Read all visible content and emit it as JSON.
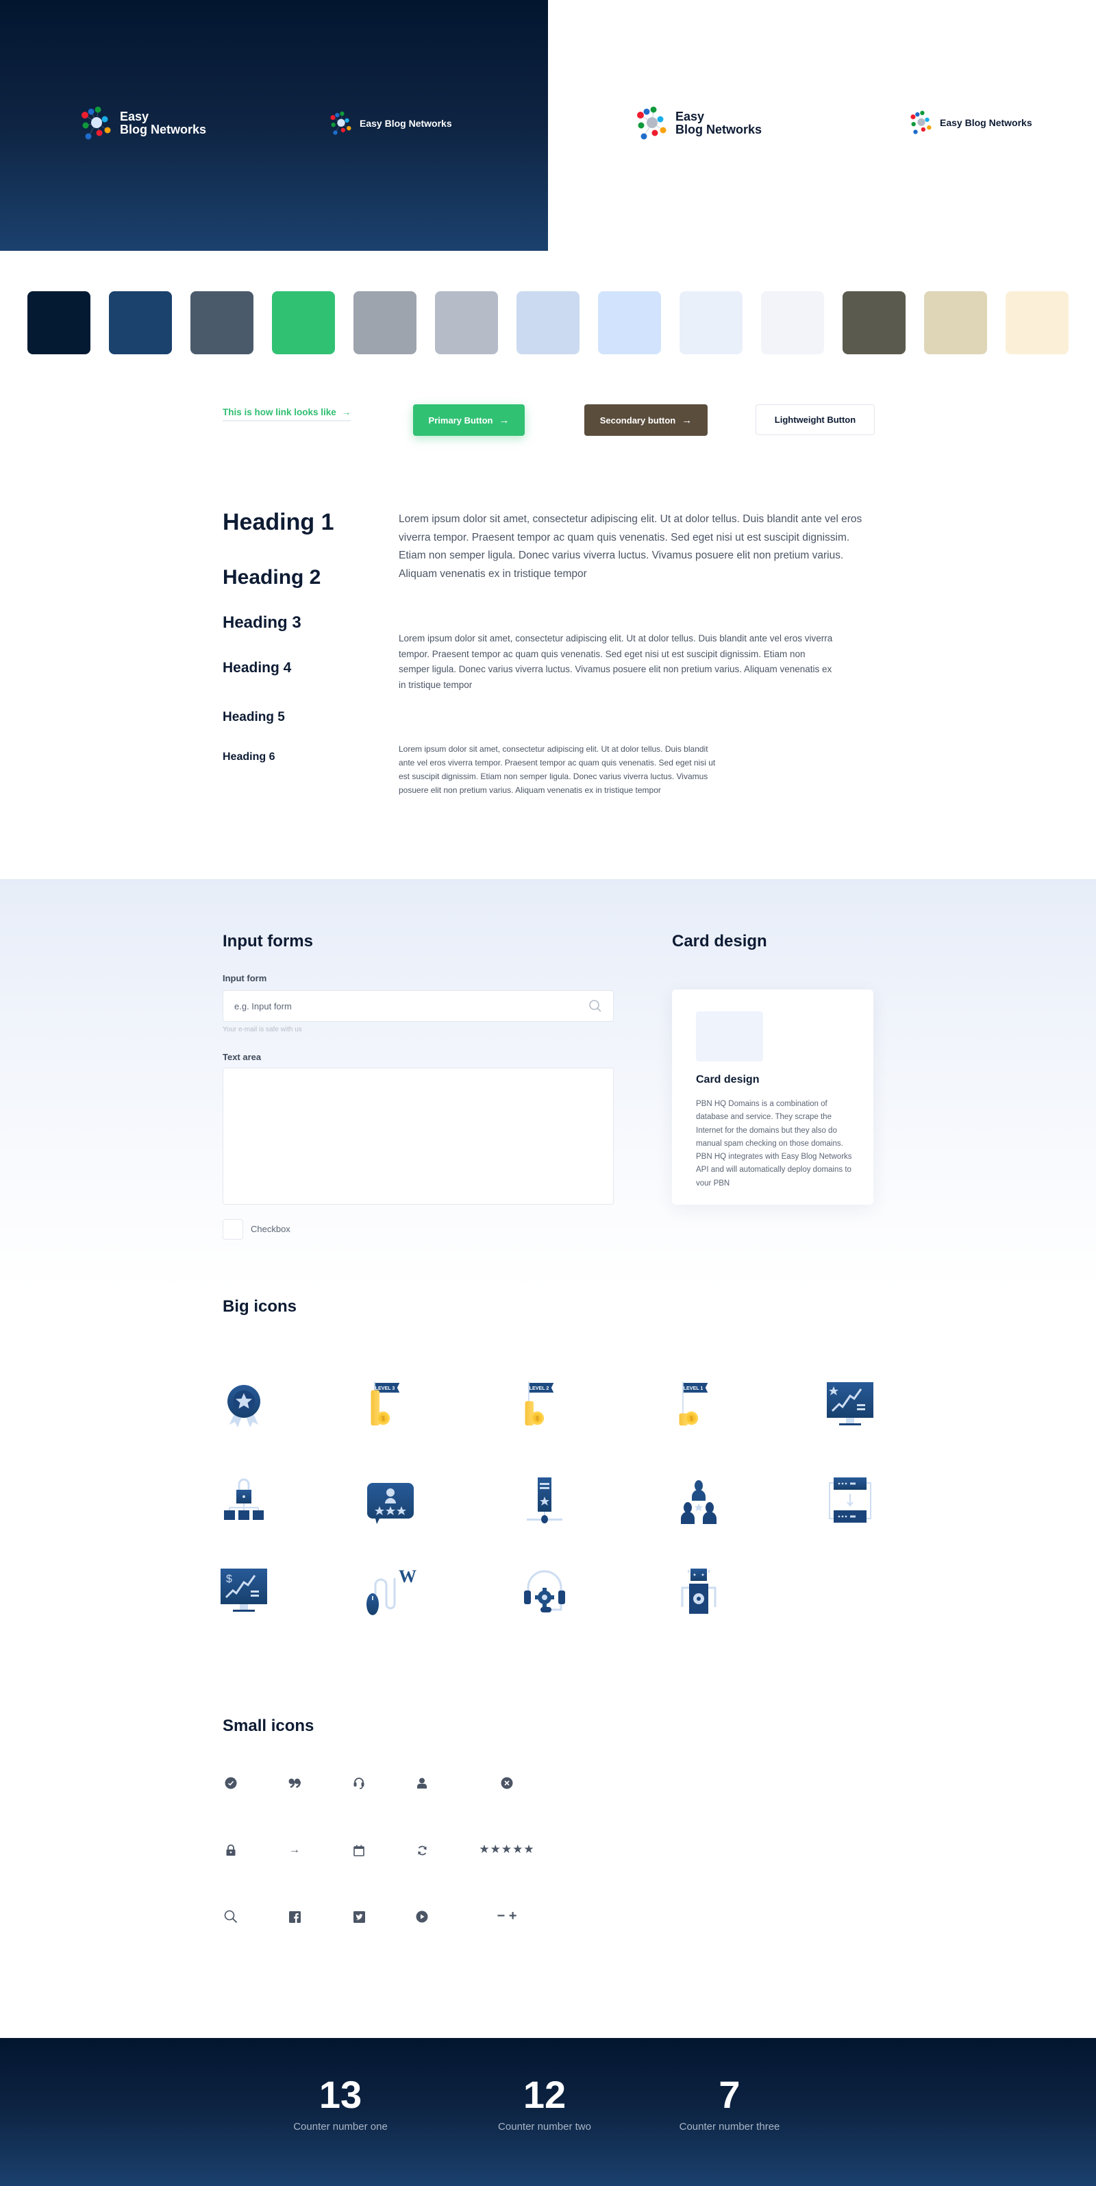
{
  "brand": {
    "name_line1": "Easy",
    "name_line2": "Blog Networks",
    "name_full": "Easy Blog Networks"
  },
  "palette": {
    "colors": [
      "#041a33",
      "#1b416d",
      "#4b5a6b",
      "#31c173",
      "#9da4ae",
      "#b5bcc8",
      "#cbdaf0",
      "#d2e4fd",
      "#eaf0fa",
      "#f2f4f9",
      "#5b5a4e",
      "#dfd6b8",
      "#fbf0d7"
    ]
  },
  "buttons": {
    "link_label": "This is how link looks like",
    "link_arrow": "→",
    "primary_label": "Primary Button",
    "secondary_label": "Secondary button",
    "lightweight_label": "Lightweight Button",
    "arrow": "→"
  },
  "typography": {
    "headings": [
      "Heading 1",
      "Heading 2",
      "Heading 3",
      "Heading 4",
      "Heading 5",
      "Heading 6"
    ],
    "paragraph_large": "Lorem ipsum dolor sit amet, consectetur adipiscing elit. Ut at dolor tellus. Duis blandit ante vel eros viverra tempor. Praesent tempor ac quam quis venenatis. Sed eget nisi ut est suscipit dignissim. Etiam non semper ligula. Donec varius viverra luctus. Vivamus posuere elit non pretium varius. Aliquam venenatis ex in tristique tempor",
    "paragraph_medium": "Lorem ipsum dolor sit amet, consectetur adipiscing elit. Ut at dolor tellus. Duis blandit ante vel eros viverra tempor. Praesent tempor ac quam quis venenatis. Sed eget nisi ut est suscipit dignissim. Etiam non semper ligula. Donec varius viverra luctus. Vivamus posuere elit non pretium varius. Aliquam venenatis ex in tristique tempor",
    "paragraph_small": "Lorem ipsum dolor sit amet, consectetur adipiscing elit. Ut at dolor tellus. Duis blandit ante vel eros viverra tempor. Praesent tempor ac quam quis venenatis. Sed eget nisi ut est suscipit dignissim. Etiam non semper ligula. Donec varius viverra luctus. Vivamus posuere elit non pretium varius. Aliquam venenatis ex in tristique tempor"
  },
  "forms": {
    "title": "Input forms",
    "input_label": "Input form",
    "input_placeholder": "e.g. Input form",
    "input_value": "",
    "input_hint": "Your e-mail is safe with us",
    "textarea_label": "Text area",
    "textarea_value": "",
    "checkbox_label": "Checkbox",
    "checkbox_checked": false
  },
  "card": {
    "section_title": "Card design",
    "title": "Card design",
    "body": "PBN HQ Domains is a combination of database and service. They scrape the Internet for the domains but they also do manual spam checking on those domains. PBN HQ integrates with Easy Blog Networks API and will automatically deploy domains to your PBN"
  },
  "big_icons": {
    "title": "Big icons",
    "items": [
      {
        "name": "award-badge-icon"
      },
      {
        "name": "level-3-coins-icon",
        "label": "LEVEL 3"
      },
      {
        "name": "level-2-coins-icon",
        "label": "LEVEL 2"
      },
      {
        "name": "level-1-coins-icon",
        "label": "LEVEL 1"
      },
      {
        "name": "growth-monitor-icon"
      },
      {
        "name": "secure-network-icon"
      },
      {
        "name": "user-review-icon"
      },
      {
        "name": "server-star-icon"
      },
      {
        "name": "team-icon"
      },
      {
        "name": "server-transfer-icon"
      },
      {
        "name": "revenue-monitor-icon"
      },
      {
        "name": "wordpress-click-icon",
        "letter": "W"
      },
      {
        "name": "support-headset-icon"
      },
      {
        "name": "robot-icon"
      }
    ]
  },
  "small_icons": {
    "title": "Small icons",
    "items": [
      {
        "name": "check-circle-icon"
      },
      {
        "name": "quote-icon"
      },
      {
        "name": "headset-icon"
      },
      {
        "name": "user-icon"
      },
      {
        "name": "close-circle-icon"
      },
      {
        "name": "lock-icon"
      },
      {
        "name": "arrow-right-icon",
        "glyph": "→"
      },
      {
        "name": "calendar-icon"
      },
      {
        "name": "refresh-icon"
      },
      {
        "name": "star-rating-icon",
        "glyph": "★★★★★"
      },
      {
        "name": "search-icon"
      },
      {
        "name": "facebook-icon"
      },
      {
        "name": "twitter-icon"
      },
      {
        "name": "play-circle-icon"
      },
      {
        "name": "minus-plus-icon",
        "glyph": "− +"
      }
    ]
  },
  "counters": [
    {
      "value": "13",
      "label": "Counter number one"
    },
    {
      "value": "12",
      "label": "Counter number two"
    },
    {
      "value": "7",
      "label": "Counter number three"
    }
  ]
}
